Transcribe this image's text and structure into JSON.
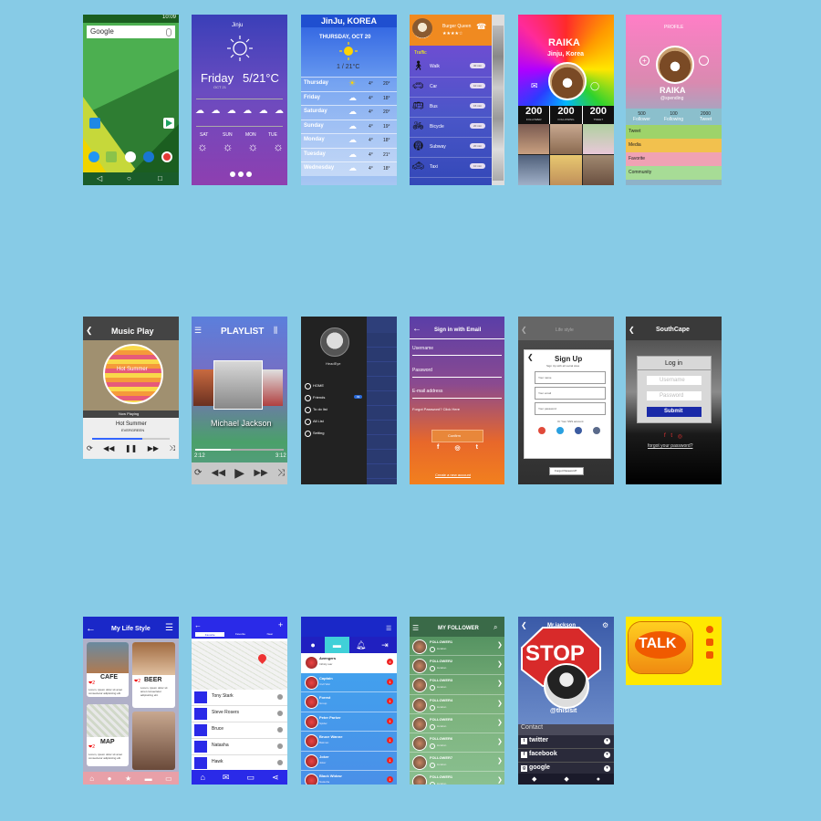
{
  "android": {
    "time": "10:09",
    "search_placeholder": "Google"
  },
  "weather_week": {
    "location": "Jinju",
    "day": "Friday",
    "temp": "5/21°C",
    "date": "OCT 21",
    "days": [
      "SAT",
      "SUN",
      "MON",
      "TUE"
    ]
  },
  "weather_city": {
    "title": "JinJu, KOREA",
    "date": "THURSDAY, OCT 20",
    "temp": "1 / 21°C",
    "rows": [
      {
        "day": "Thursday",
        "low": "4°",
        "high": "20°"
      },
      {
        "day": "Friday",
        "low": "4°",
        "high": "18°"
      },
      {
        "day": "Saturday",
        "low": "4°",
        "high": "20°"
      },
      {
        "day": "Sunday",
        "low": "4°",
        "high": "19°"
      },
      {
        "day": "Monday",
        "low": "4°",
        "high": "18°"
      },
      {
        "day": "Tuesday",
        "low": "4°",
        "high": "21°"
      },
      {
        "day": "Wednesday",
        "low": "4°",
        "high": "18°"
      }
    ]
  },
  "traffic": {
    "place": "Burger Queen",
    "stars": "★★★★☆",
    "section": "Traffic",
    "items": [
      {
        "label": "Walk",
        "time": "30 min"
      },
      {
        "label": "Car",
        "time": "10 min"
      },
      {
        "label": "Bus",
        "time": "15 min"
      },
      {
        "label": "Bicycle",
        "time": "20 min"
      },
      {
        "label": "Subway",
        "time": "20 min"
      },
      {
        "label": "Taxi",
        "time": "10 min"
      }
    ]
  },
  "raika_color": {
    "name": "RAIKA",
    "location": "Jinju, Korea",
    "stats": [
      {
        "value": "200",
        "label": "FOLLOWER"
      },
      {
        "value": "200",
        "label": "FOLLOWING"
      },
      {
        "value": "200",
        "label": "TWEET"
      }
    ]
  },
  "raika_profile": {
    "header": "PROFILE",
    "name": "RAIKA",
    "handle": "@spending",
    "stats": [
      {
        "value": "500",
        "label": "Follower"
      },
      {
        "value": "100",
        "label": "Following"
      },
      {
        "value": "2000",
        "label": "Tweet"
      }
    ],
    "menu": [
      {
        "label": "Tweet",
        "color": "#9ed36a"
      },
      {
        "label": "Media",
        "color": "#f2c14e"
      },
      {
        "label": "Favorite",
        "color": "#f0a2b4"
      },
      {
        "label": "Community",
        "color": "#a7dc96"
      }
    ]
  },
  "music_play": {
    "title": "Music Play",
    "album": "Hot Summer",
    "now_playing": "Now Playing",
    "song": "Hot Summer",
    "artist": "EVERGREEN"
  },
  "playlist": {
    "title": "PLAYLIST",
    "artist": "Michael Jackson",
    "time_start": "2:12",
    "time_end": "3:12"
  },
  "side_menu": {
    "user": "HeadEye",
    "items": [
      "HOME",
      "Friends",
      "To do list",
      "All List",
      "Setting"
    ],
    "badge": "99"
  },
  "signin": {
    "title": "Sign in with Email",
    "username": "Username",
    "password": "Password",
    "email": "E-mail address",
    "forgot": "Forgot Password? Click Here",
    "confirm": "Confirm",
    "create": "Create a new account"
  },
  "signup": {
    "bg_title": "Life style",
    "title": "Sign Up",
    "subtitle": "Sign Up with all social sites",
    "fields": [
      "Your name",
      "Your email",
      "Your password"
    ],
    "or_text": "Or Your SNS account",
    "forgot": "Forgot Password?"
  },
  "southcape": {
    "title": "SouthCape",
    "login": "Log in",
    "username": "Username",
    "password": "Password",
    "submit": "Submit",
    "forgot": "forgot your password?"
  },
  "lifestyle": {
    "title": "My Life Style",
    "cards": [
      {
        "title": "CAFE",
        "likes": "2"
      },
      {
        "title": "BEER",
        "likes": "2"
      },
      {
        "title": "MAP",
        "likes": "2"
      }
    ],
    "lorem": "Lorem, ipsum dolor sit amet consectetur adipisicing elit."
  },
  "map_contacts": {
    "tabs": [
      "Favorite",
      "Favorite",
      "Near"
    ],
    "people": [
      "Tony Stark",
      "Steve Rosers",
      "Bruce",
      "Natasha",
      "Hawk"
    ]
  },
  "hero_list": {
    "items": [
      {
        "name": "Avengers",
        "sub": "Infinity war",
        "badge": "4"
      },
      {
        "name": "Captain",
        "sub": "Civil War",
        "badge": "1"
      },
      {
        "name": "Forest",
        "sub": "Group",
        "badge": "1"
      },
      {
        "name": "Peter Parker",
        "sub": "Spider",
        "badge": "1"
      },
      {
        "name": "Bruce Wanne",
        "sub": "Batman",
        "badge": "1"
      },
      {
        "name": "Joker",
        "sub": "Joker",
        "badge": "1"
      },
      {
        "name": "Black Widow",
        "sub": "Natasha",
        "badge": "1"
      }
    ]
  },
  "my_follower": {
    "title": "MY FOLLOWER",
    "items": [
      "FOLLOWER1",
      "FOLLOWER2",
      "FOLLOWER3",
      "FOLLOWER4",
      "FOLLOWER5",
      "FOLLOWER6",
      "FOLLOWER7",
      "FOLLOWER1"
    ],
    "sub": "location"
  },
  "mrjackson": {
    "title": "Mr.jackson",
    "sign": "STOP",
    "handle": "@thisisit",
    "contact": "Contact",
    "links": [
      "twitter",
      "facebook",
      "google"
    ]
  },
  "talk": {
    "logo": "TALK"
  }
}
